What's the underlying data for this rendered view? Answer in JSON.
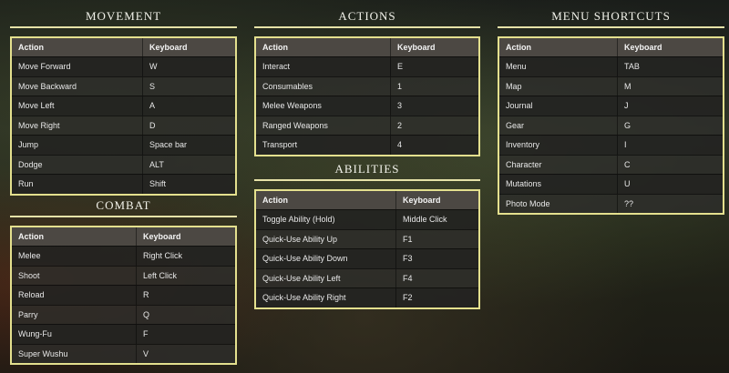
{
  "sections": {
    "movement": {
      "title": "Movement",
      "headers": [
        "Action",
        "Keyboard"
      ],
      "rows": [
        [
          "Move Forward",
          "W"
        ],
        [
          "Move Backward",
          "S"
        ],
        [
          "Move Left",
          "A"
        ],
        [
          "Move Right",
          "D"
        ],
        [
          "Jump",
          "Space bar"
        ],
        [
          "Dodge",
          "ALT"
        ],
        [
          "Run",
          "Shift"
        ]
      ]
    },
    "combat": {
      "title": "Combat",
      "headers": [
        "Action",
        "Keyboard"
      ],
      "rows": [
        [
          "Melee",
          "Right Click"
        ],
        [
          "Shoot",
          "Left Click"
        ],
        [
          "Reload",
          "R"
        ],
        [
          "Parry",
          "Q"
        ],
        [
          "Wung-Fu",
          "F"
        ],
        [
          "Super Wushu",
          "V"
        ]
      ]
    },
    "actions": {
      "title": "Actions",
      "headers": [
        "Action",
        "Keyboard"
      ],
      "rows": [
        [
          "Interact",
          "E"
        ],
        [
          "Consumables",
          "1"
        ],
        [
          "Melee Weapons",
          "3"
        ],
        [
          "Ranged Weapons",
          "2"
        ],
        [
          "Transport",
          "4"
        ]
      ]
    },
    "abilities": {
      "title": "Abilities",
      "headers": [
        "Action",
        "Keyboard"
      ],
      "rows": [
        [
          "Toggle Ability (Hold)",
          "Middle Click"
        ],
        [
          "Quick-Use Ability Up",
          "F1"
        ],
        [
          "Quick-Use Ability Down",
          "F3"
        ],
        [
          "Quick-Use Ability Left",
          "F4"
        ],
        [
          "Quick-Use Ability Right",
          "F2"
        ]
      ]
    },
    "menu_shortcuts": {
      "title": "Menu Shortcuts",
      "headers": [
        "Action",
        "Keyboard"
      ],
      "rows": [
        [
          "Menu",
          "TAB"
        ],
        [
          "Map",
          "M"
        ],
        [
          "Journal",
          "J"
        ],
        [
          "Gear",
          "G"
        ],
        [
          "Inventory",
          "I"
        ],
        [
          "Character",
          "C"
        ],
        [
          "Mutations",
          "U"
        ],
        [
          "Photo Mode",
          "??"
        ]
      ]
    }
  },
  "colors": {
    "accent_border": "#e4e08e",
    "header_bg": "#4c4843"
  }
}
